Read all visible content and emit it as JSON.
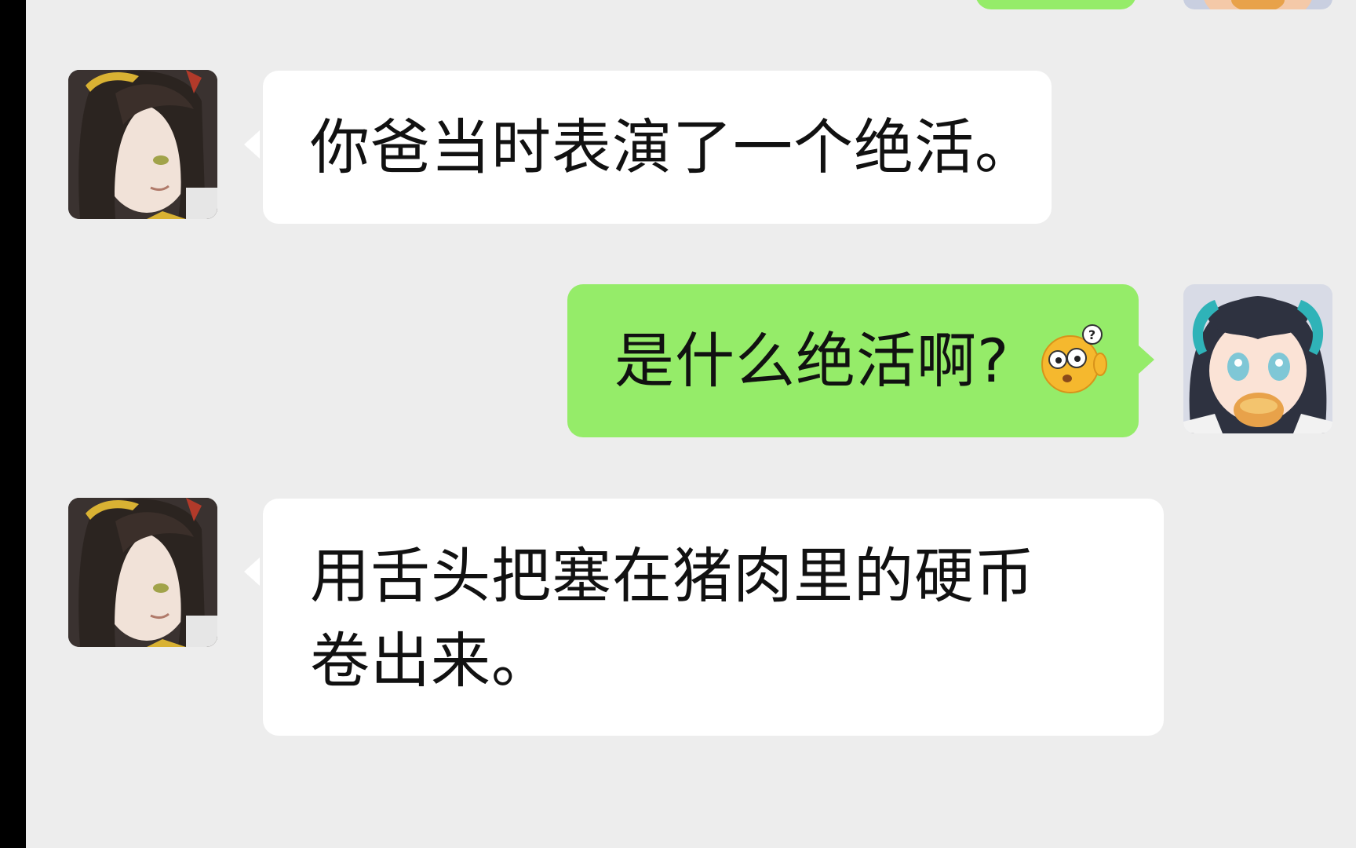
{
  "conversation": {
    "messages": [
      {
        "sender": "contact",
        "text": "你爸当时表演了一个绝活。"
      },
      {
        "sender": "me",
        "text": "是什么绝活啊?",
        "emoji": "confused-question-emoji"
      },
      {
        "sender": "contact",
        "text": "用舌头把塞在猪肉里的硬币卷出来。"
      }
    ]
  },
  "colors": {
    "background": "#ededed",
    "incoming_bubble": "#ffffff",
    "outgoing_bubble": "#95ec69",
    "left_bar": "#000000"
  }
}
